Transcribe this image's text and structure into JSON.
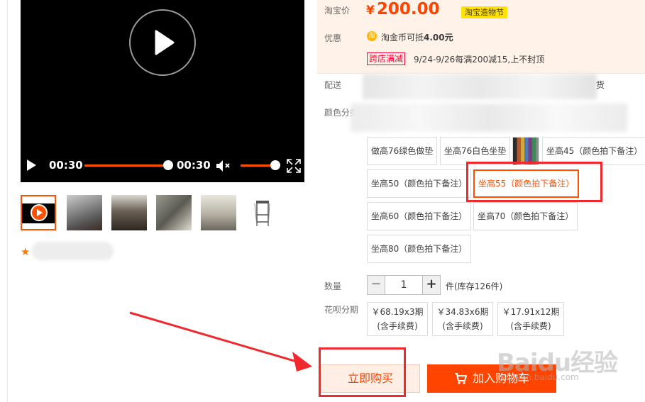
{
  "video": {
    "current_time": "00:30",
    "duration": "00:30",
    "progress_fraction": 1.0,
    "volume_fraction": 1.0
  },
  "thumbnails": [
    {
      "name": "video-thumb",
      "selected": true
    },
    {
      "name": "photo-1"
    },
    {
      "name": "photo-2"
    },
    {
      "name": "photo-3"
    },
    {
      "name": "photo-4"
    },
    {
      "name": "photo-5"
    }
  ],
  "price": {
    "label": "淘宝价",
    "currency": "¥",
    "amount": "200.00",
    "badge": "淘宝造物节"
  },
  "promo": {
    "label": "优惠",
    "coin_icon": "淘",
    "coin_text": "淘金币可抵",
    "coin_value": "4.00元",
    "store_tag": "跨店满减",
    "store_text": "9/24-9/26每满200减15,上不封顶"
  },
  "shipping": {
    "label": "配送",
    "tail": "货"
  },
  "colors": {
    "label": "颜色分类",
    "options": [
      "做高76绿色做垫",
      "坐高76白色坐垫",
      "坐高45（颜色拍下备注）",
      "坐高50（颜色拍下备注）",
      "坐高55（颜色拍下备注）",
      "坐高60（颜色拍下备注）",
      "坐高70（颜色拍下备注）",
      "坐高80（颜色拍下备注）"
    ],
    "selected_index": 4
  },
  "quantity": {
    "label": "数量",
    "minus": "−",
    "value": "1",
    "plus": "+",
    "stock_text": "件(库存126件)"
  },
  "installment": {
    "label": "花呗分期",
    "plans": [
      {
        "amount": "￥68.19x3期",
        "fee": "(含手续费)"
      },
      {
        "amount": "￥34.83x6期",
        "fee": "(含手续费)"
      },
      {
        "amount": "￥17.91x12期",
        "fee": "(含手续费)"
      }
    ]
  },
  "actions": {
    "buy_now": "立即购买",
    "add_to_cart": "加入购物车"
  },
  "watermark": {
    "text": "Baidu经验",
    "sub": "jingyan.baidu.com"
  },
  "colors_theme": {
    "accent": "#ff5000",
    "price": "#ff4400",
    "annotation": "#f0292e"
  }
}
